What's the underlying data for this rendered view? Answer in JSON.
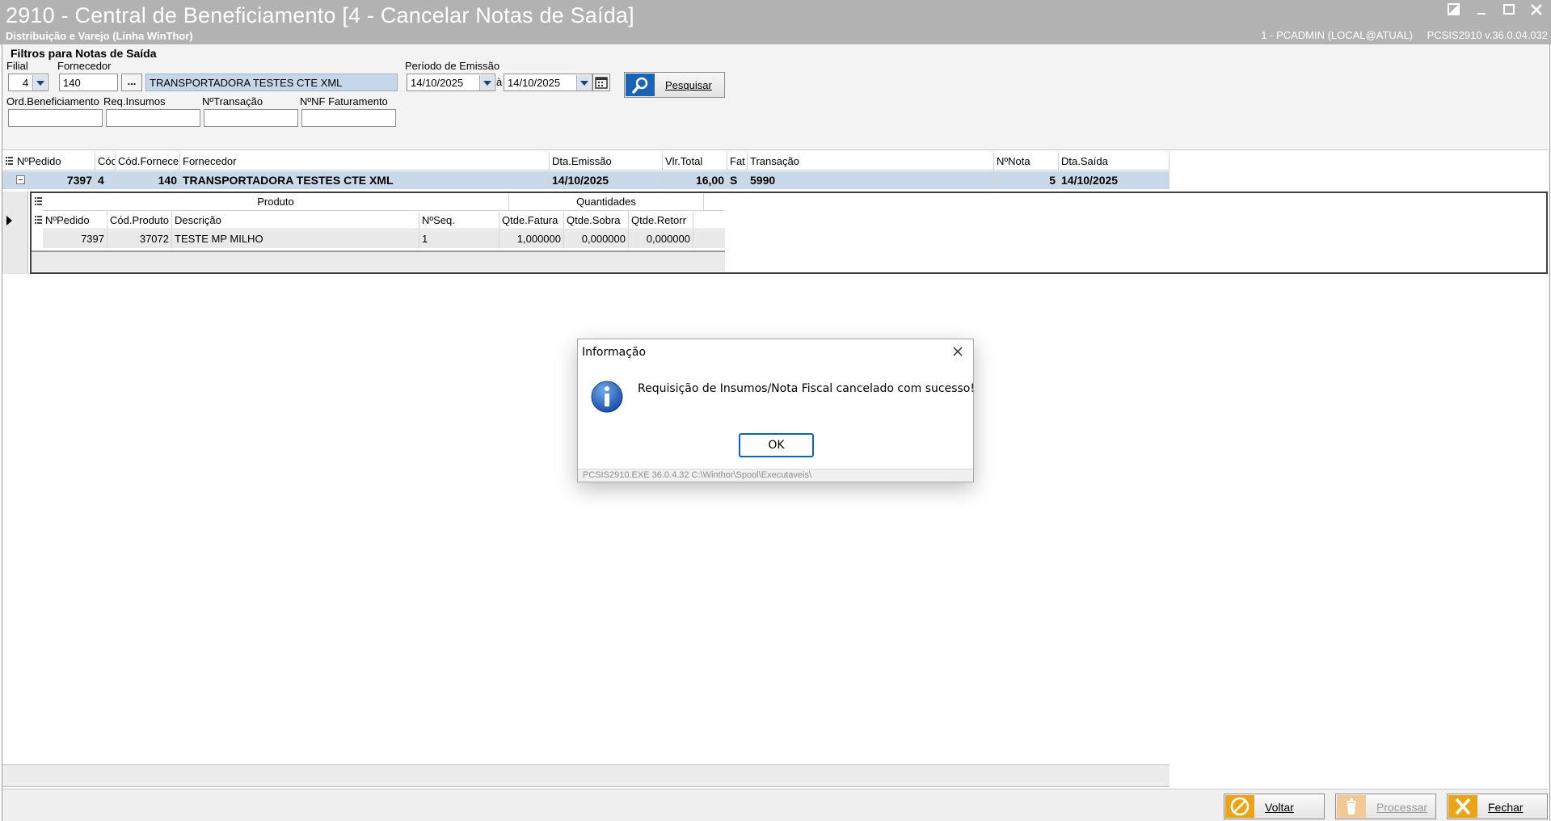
{
  "window": {
    "title": "2910 - Central de Beneficiamento [4 - Cancelar Notas de Saída]",
    "subtitle": "Distribuição e Varejo (Linha WinThor)",
    "user_info": "1 - PCADMIN (LOCAL@ATUAL)",
    "app_info": "PCSIS2910  v.36.0.04.032"
  },
  "filters": {
    "panel_title": "Filtros para Notas de Saída",
    "filial_label": "Filial",
    "filial_value": "4",
    "fornecedor_label": "Fornecedor",
    "fornecedor_code": "140",
    "fornecedor_lookup_label": "...",
    "fornecedor_name": "TRANSPORTADORA TESTES CTE XML",
    "periodo_label": "Período de Emissão",
    "date_from": "14/10/2025",
    "date_sep": "à",
    "date_to": "14/10/2025",
    "search_label": "Pesquisar",
    "ord_benef_label": "Ord.Beneficiamento",
    "req_insumos_label": "Req.Insumos",
    "ntransacao_label": "NºTransação",
    "nnf_label": "NºNF Faturamento",
    "ord_benef_value": "",
    "req_insumos_value": "",
    "ntransacao_value": "",
    "nnf_value": ""
  },
  "grid": {
    "headers": [
      "NºPedido",
      "Cód",
      "Cód.Fornece",
      "Fornecedor",
      "Dta.Emissão",
      "Vlr.Total",
      "Fat",
      "Transação",
      "NºNota",
      "Dta.Saída"
    ],
    "row": {
      "pedido": "7397",
      "cod": "4",
      "cod_fornec": "140",
      "fornecedor": "TRANSPORTADORA TESTES CTE XML",
      "dta_emissao": "14/10/2025",
      "vlr_total": "16,00",
      "fat": "S",
      "transacao": "5990",
      "nota": "5",
      "dta_saida": "14/10/2025"
    },
    "sub": {
      "group_produto": "Produto",
      "group_quantidades": "Quantidades",
      "headers": [
        "NºPedido",
        "Cód.Produto",
        "Descrição",
        "NºSeq.",
        "Qtde.Fatura",
        "Qtde.Sobra",
        "Qtde.Retorr"
      ],
      "row": {
        "pedido": "7397",
        "cod_produto": "37072",
        "descricao": "TESTE MP MILHO",
        "seq": "1",
        "qtde_fatura": "1,000000",
        "qtde_sobra": "0,000000",
        "qtde_retorno": "0,000000"
      }
    }
  },
  "buttons": {
    "voltar": "Voltar",
    "processar": "Processar",
    "fechar": "Fechar"
  },
  "dialog": {
    "title": "Informação",
    "message": "Requisição de Insumos/Nota Fiscal cancelado com sucesso!",
    "ok_label": "OK",
    "footer": "PCSIS2910.EXE 36.0.4.32 C:\\Winthor\\Spool\\Executaveis\\"
  },
  "colors": {
    "titlebar": "#b2b2b2",
    "selected_row": "#c9d9e9",
    "accent_blue": "#1d63b4",
    "ok_border": "#0a64c8"
  }
}
